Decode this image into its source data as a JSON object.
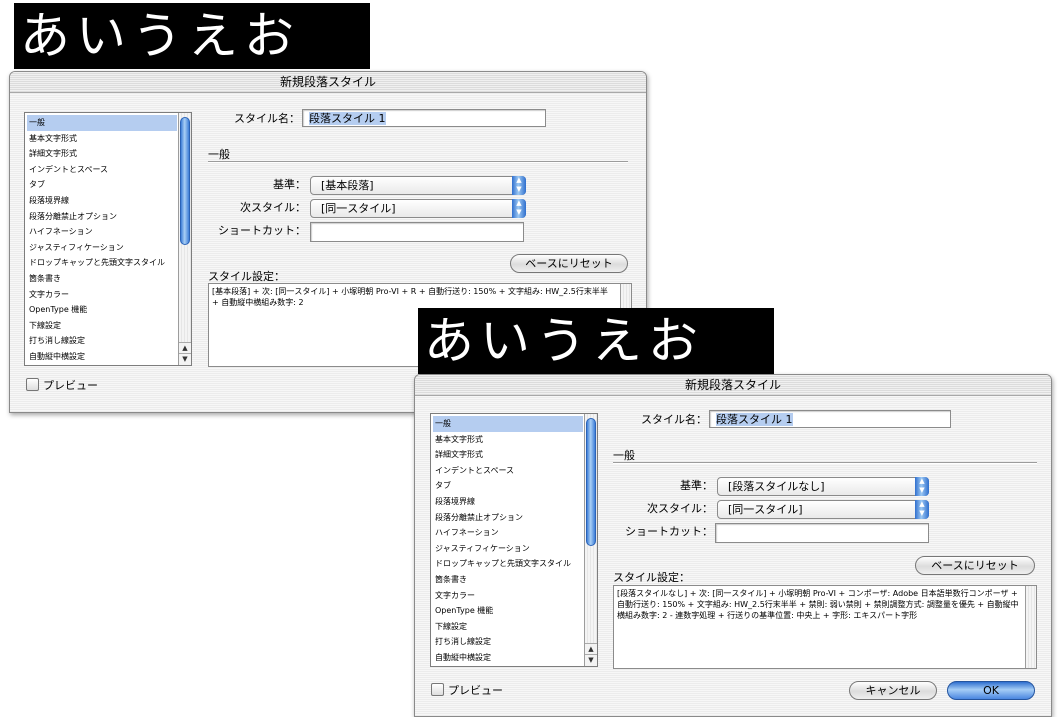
{
  "banner_text": "あいうえお",
  "dialog1": {
    "title": "新規段落スタイル",
    "style_name_label": "スタイル名：",
    "style_name_value": "段落スタイル 1",
    "section_label": "一般",
    "based_on_label": "基準：",
    "based_on_value": "[基本段落]",
    "next_style_label": "次スタイル：",
    "next_style_value": "[同一スタイル]",
    "shortcut_label": "ショートカット：",
    "shortcut_value": "",
    "reset_button": "ベースにリセット",
    "style_settings_label": "スタイル設定：",
    "style_settings_text": "[基本段落] + 次: [同一スタイル] + 小塚明朝 Pro-VI + R + 自動行送り: 150% + 文字組み: HW_2.5行末半半 + 自動縦中横組み数字: 2",
    "preview_label": "プレビュー",
    "list_items": [
      "一般",
      "基本文字形式",
      "詳細文字形式",
      "インデントとスペース",
      "タブ",
      "段落境界線",
      "段落分離禁止オプション",
      "ハイフネーション",
      "ジャスティフィケーション",
      "ドロップキャップと先頭文字スタイル",
      "箇条書き",
      "文字カラー",
      "OpenType 機能",
      "下線設定",
      "打ち消し線設定",
      "自動縦中横設定"
    ]
  },
  "dialog2": {
    "title": "新規段落スタイル",
    "style_name_label": "スタイル名：",
    "style_name_value": "段落スタイル 1",
    "section_label": "一般",
    "based_on_label": "基準：",
    "based_on_value": "[段落スタイルなし]",
    "next_style_label": "次スタイル：",
    "next_style_value": "[同一スタイル]",
    "shortcut_label": "ショートカット：",
    "shortcut_value": "",
    "reset_button": "ベースにリセット",
    "style_settings_label": "スタイル設定：",
    "style_settings_text": "[段落スタイルなし] + 次: [同一スタイル] + 小塚明朝 Pro-VI + コンポーザ: Adobe 日本語単数行コンポーザ + 自動行送り: 150% + 文字組み: HW_2.5行末半半 + 禁則: 弱い禁則 + 禁則調整方式: 調整量を優先 + 自動縦中横組み数字: 2 - 連数字処理 + 行送りの基準位置: 中央上 + 字形: エキスパート字形",
    "preview_label": "プレビュー",
    "cancel_button": "キャンセル",
    "ok_button": "OK",
    "list_items": [
      "一般",
      "基本文字形式",
      "詳細文字形式",
      "インデントとスペース",
      "タブ",
      "段落境界線",
      "段落分離禁止オプション",
      "ハイフネーション",
      "ジャスティフィケーション",
      "ドロップキャップと先頭文字スタイル",
      "箇条書き",
      "文字カラー",
      "OpenType 機能",
      "下線設定",
      "打ち消し線設定",
      "自動縦中横設定"
    ]
  }
}
